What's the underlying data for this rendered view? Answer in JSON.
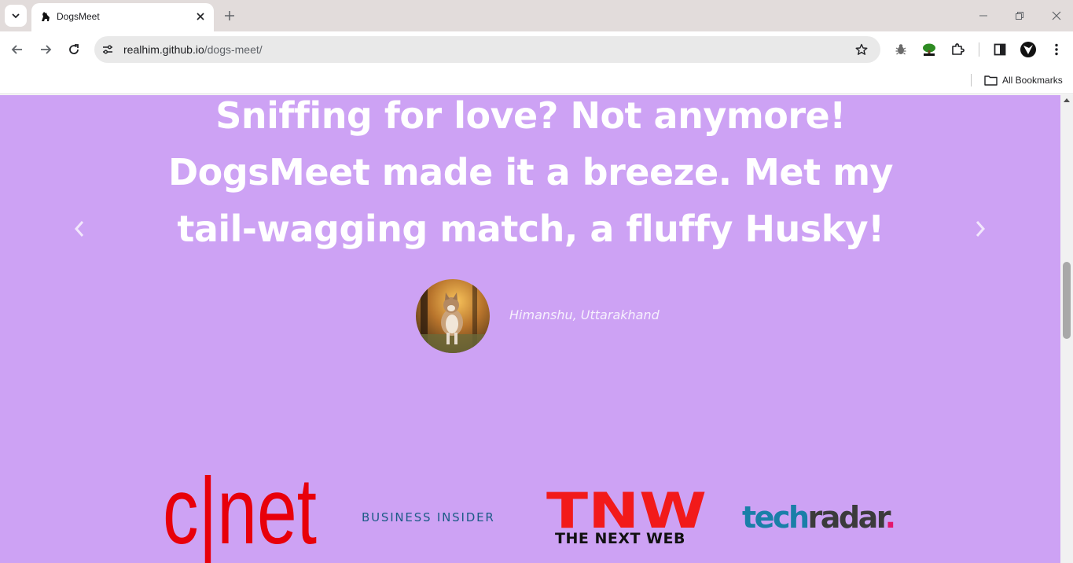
{
  "browser": {
    "tab_title": "DogsMeet",
    "url_host": "realhim.github.io",
    "url_path": "/dogs-meet/",
    "bookmarks_label": "All Bookmarks"
  },
  "page": {
    "testimonial_quote": "Sniffing for love? Not anymore! DogsMeet made it a breeze. Met my tail-wagging match, a fluffy Husky!",
    "author": "Himanshu, Uttarakhand",
    "logos": {
      "cnet": "c|net",
      "business_insider": "BUSINESS INSIDER",
      "tnw_mark": "TNW",
      "tnw_sub": "THE NEXT WEB",
      "techradar_tech": "tech",
      "techradar_radar": "radar",
      "techradar_dot": "."
    }
  },
  "colors": {
    "page_bg": "#cda2f4",
    "cnet_red": "#e8000a",
    "tnw_red": "#f21a1a",
    "bi_blue": "#1c5b86",
    "techradar_blue": "#1a7fa8"
  }
}
